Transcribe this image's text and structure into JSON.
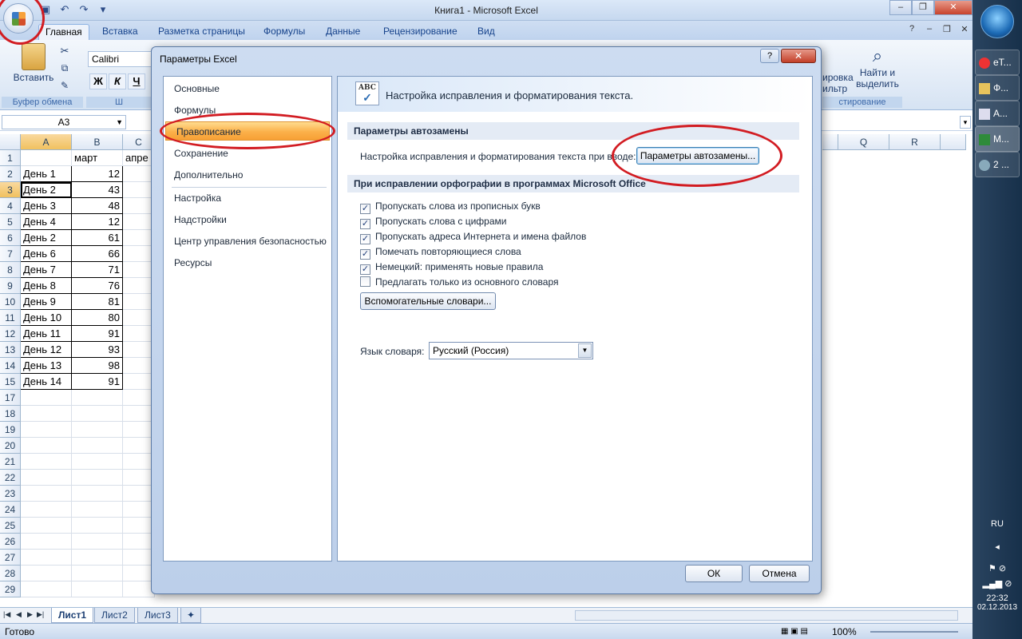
{
  "window": {
    "title": "Книга1 - Microsoft Excel"
  },
  "ribbon_tabs": [
    "Главная",
    "Вставка",
    "Разметка страницы",
    "Формулы",
    "Данные",
    "Рецензирование",
    "Вид"
  ],
  "ribbon": {
    "paste_label": "Вставить",
    "clipboard_group": "Буфер обмена",
    "font_name": "Calibri",
    "bold": "Ж",
    "italic": "К",
    "underline": "Ч",
    "font_group_partial": "Ш",
    "sort_partial": "ировка",
    "filter_partial": "ильтр",
    "editing_group_partial": "стирование",
    "find_label_1": "Найти и",
    "find_label_2": "выделить"
  },
  "namebox": "A3",
  "columns": [
    "A",
    "B",
    "C",
    "Q",
    "R"
  ],
  "rows": [
    {
      "n": "1",
      "a": "",
      "b": "март",
      "c": "апре"
    },
    {
      "n": "2",
      "a": "День 1",
      "b": "12"
    },
    {
      "n": "3",
      "a": "День 2",
      "b": "43"
    },
    {
      "n": "4",
      "a": "День 3",
      "b": "48"
    },
    {
      "n": "5",
      "a": "День 4",
      "b": "12"
    },
    {
      "n": "6",
      "a": "День 2",
      "b": "61"
    },
    {
      "n": "7",
      "a": "День 6",
      "b": "66"
    },
    {
      "n": "8",
      "a": "День 7",
      "b": "71"
    },
    {
      "n": "9",
      "a": "День 8",
      "b": "76"
    },
    {
      "n": "10",
      "a": "День 9",
      "b": "81"
    },
    {
      "n": "11",
      "a": "День 10",
      "b": "80"
    },
    {
      "n": "12",
      "a": "День 11",
      "b": "91"
    },
    {
      "n": "13",
      "a": "День 12",
      "b": "93"
    },
    {
      "n": "14",
      "a": "День 13",
      "b": "98"
    },
    {
      "n": "15",
      "a": "День 14",
      "b": "91"
    },
    {
      "n": "17"
    },
    {
      "n": "18"
    },
    {
      "n": "19"
    },
    {
      "n": "20"
    },
    {
      "n": "21"
    },
    {
      "n": "22"
    },
    {
      "n": "23"
    },
    {
      "n": "24"
    },
    {
      "n": "25"
    },
    {
      "n": "26"
    },
    {
      "n": "27"
    },
    {
      "n": "28"
    },
    {
      "n": "29"
    }
  ],
  "sheets": [
    "Лист1",
    "Лист2",
    "Лист3"
  ],
  "status": {
    "ready": "Готово",
    "zoom": "100%"
  },
  "taskbar": {
    "items": [
      "eT...",
      "Ф...",
      "A...",
      "M...",
      "2 ..."
    ],
    "lang": "RU",
    "time": "22:32",
    "date": "02.12.2013"
  },
  "dialog": {
    "title": "Параметры Excel",
    "help": "?",
    "close": "✕",
    "nav": [
      "Основные",
      "Формулы",
      "Правописание",
      "Сохранение",
      "Дополнительно",
      "Настройка",
      "Надстройки",
      "Центр управления безопасностью",
      "Ресурсы"
    ],
    "header_text": "Настройка исправления и форматирования текста.",
    "autocorrect_section": "Параметры автозамены",
    "autocorrect_row_text": "Настройка исправления и форматирования текста при вводе:",
    "autocorrect_button": "Параметры автозамены...",
    "spelling_section": "При исправлении орфографии в программах Microsoft Office",
    "options": [
      {
        "label": "Пропускать слова из прописных букв",
        "checked": true
      },
      {
        "label": "Пропускать слова с цифрами",
        "checked": true
      },
      {
        "label": "Пропускать адреса Интернета и имена файлов",
        "checked": true
      },
      {
        "label": "Помечать повторяющиеся слова",
        "checked": true
      },
      {
        "label": "Немецкий: применять новые правила",
        "checked": true
      },
      {
        "label": "Предлагать только из основного словаря",
        "checked": false
      }
    ],
    "custom_dictionaries_button": "Вспомогательные словари...",
    "dictionary_language_label": "Язык словаря:",
    "dictionary_language_value": "Русский (Россия)",
    "ok": "ОК",
    "cancel": "Отмена"
  },
  "colors": {
    "annotation": "#d21c22",
    "nav_active": "#fbb04a",
    "accent": "#15428b"
  }
}
